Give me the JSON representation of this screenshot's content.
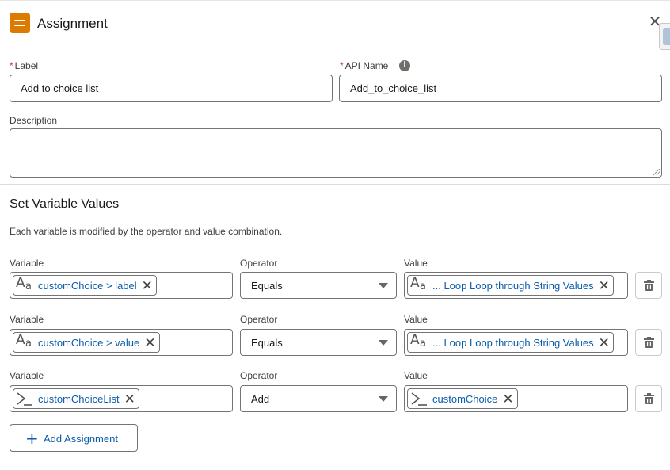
{
  "header": {
    "title": "Assignment",
    "icon": "assignment-icon",
    "accent_color": "#dd7a01"
  },
  "fields": {
    "label_label": "Label",
    "label_value": "Add to choice list",
    "api_name_label": "API Name",
    "api_name_value": "Add_to_choice_list",
    "description_label": "Description",
    "description_value": "",
    "required_marker": "*"
  },
  "section": {
    "title": "Set Variable Values",
    "description": "Each variable is modified by the operator and value combination."
  },
  "columns": {
    "variable": "Variable",
    "operator": "Operator",
    "value": "Value"
  },
  "rows": [
    {
      "variable": "customChoice > label",
      "variable_icon": "text-icon",
      "operator": "Equals",
      "value": "... Loop Loop through String Values",
      "value_icon": "text-icon"
    },
    {
      "variable": "customChoice > value",
      "variable_icon": "text-icon",
      "operator": "Equals",
      "value": "... Loop Loop through String Values",
      "value_icon": "text-icon"
    },
    {
      "variable": "customChoiceList",
      "variable_icon": "prompt-icon",
      "operator": "Add",
      "value": "customChoice",
      "value_icon": "prompt-icon"
    }
  ],
  "add_button": {
    "label": "Add Assignment"
  },
  "colors": {
    "link": "#0b5cab",
    "required": "#c23934",
    "border": "#747474"
  }
}
